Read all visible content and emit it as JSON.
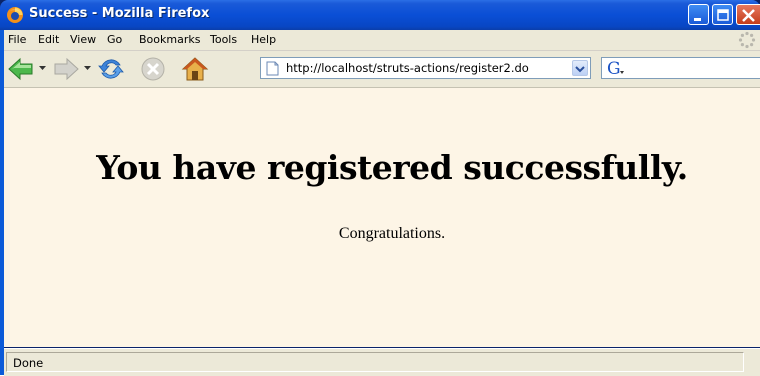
{
  "window": {
    "title": "Success - Mozilla Firefox"
  },
  "menu": {
    "items": [
      "File",
      "Edit",
      "View",
      "Go",
      "Bookmarks",
      "Tools",
      "Help"
    ]
  },
  "toolbar": {
    "buttons": [
      "back-icon",
      "forward-icon",
      "reload-icon",
      "stop-icon",
      "home-icon"
    ],
    "url": "http://localhost/struts-actions/register2.do",
    "search_engine_icon": "google-icon"
  },
  "page": {
    "heading": "You have registered successfully.",
    "message": "Congratulations.",
    "background": "#fdf5e6"
  },
  "status": {
    "text": "Done"
  },
  "colors": {
    "titlebar": "#0a4fd6",
    "chrome": "#ece9d8",
    "back_arrow": "#3aa53a"
  }
}
